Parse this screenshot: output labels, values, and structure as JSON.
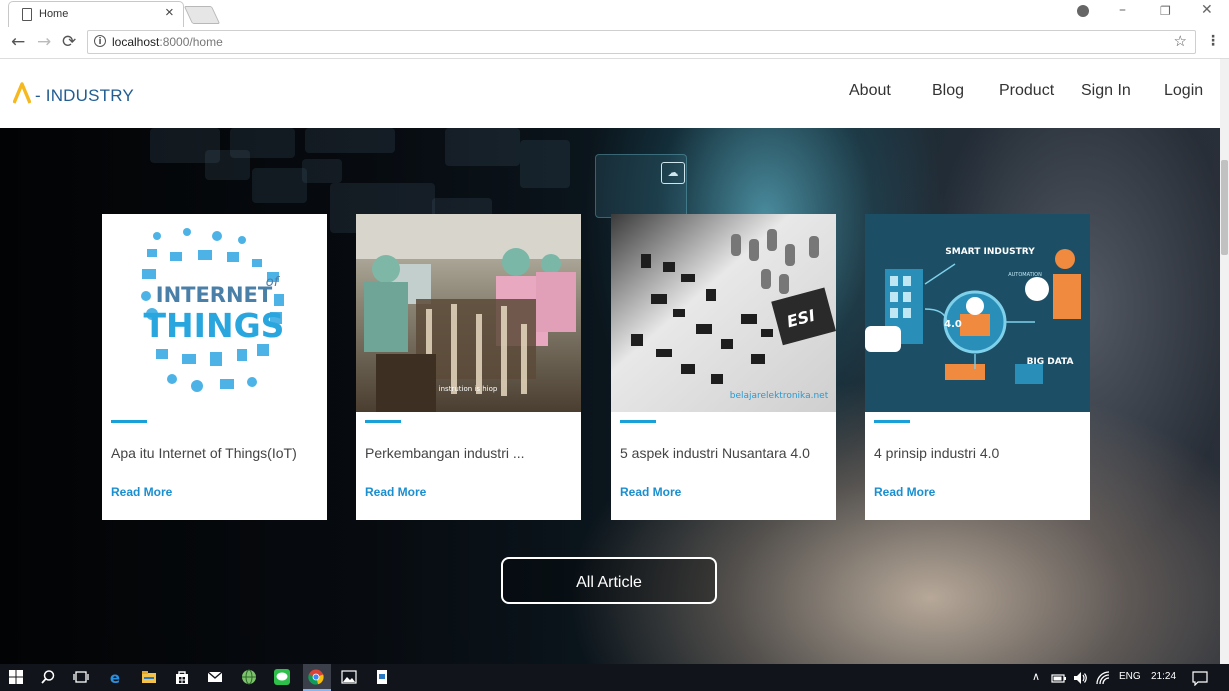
{
  "browser": {
    "tab_title": "Home",
    "tab_close": "×",
    "url_host": "localhost",
    "url_path": ":8000/home",
    "back_icon": "←",
    "forward_icon": "→",
    "reload_icon": "⟳",
    "minimize_icon": "–",
    "restore_icon": "❐",
    "close_icon": "✕",
    "star_icon": "☆",
    "menu_icon": "⋮",
    "info_icon": "i"
  },
  "site": {
    "logo_text": "- INDUSTRY",
    "logo_color": "#f5b81f",
    "brand_color": "#215d93",
    "nav": {
      "about": "About",
      "blog": "Blog",
      "product": "Product",
      "signin": "Sign In",
      "login": "Login"
    }
  },
  "cards": [
    {
      "title": "Apa itu Internet of Things(IoT)",
      "link": "Read More",
      "image": "internet-of-things-illustration"
    },
    {
      "title": "Perkembangan industri ...",
      "link": "Read More",
      "image": "factory-workers-photo"
    },
    {
      "title": "5 aspek industri Nusantara 4.0",
      "link": "Read More",
      "image": "circuit-board-photo"
    },
    {
      "title": "4 prinsip industri 4.0",
      "link": "Read More",
      "image": "smart-industry-illustration"
    }
  ],
  "card_images": {
    "iot_word1": "INTERNET",
    "iot_word2": "of",
    "iot_word3": "THINGS",
    "factory_caption": "instrution is hiop",
    "circuit_brand": "ESI",
    "circuit_watermark": "belajarelektronika.net",
    "smart_title": "SMART INDUSTRY",
    "smart_big_data": "BIG DATA",
    "smart_automation": "AUTOMATION",
    "smart_version": "4.0"
  },
  "all_article_label": "All Article",
  "accent_color": "#1aa0d8",
  "taskbar": {
    "lang": "ENG",
    "time": "21:24"
  }
}
